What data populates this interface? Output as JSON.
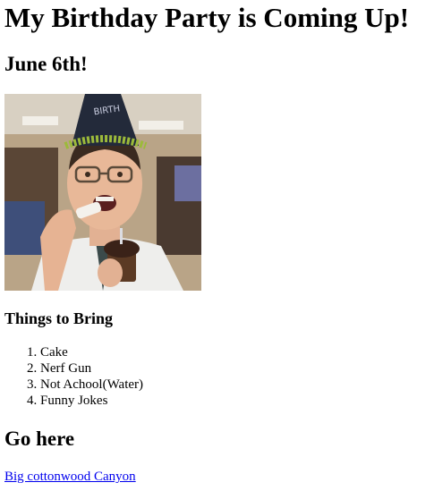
{
  "page": {
    "title": "My Birthday Party is Coming Up!",
    "date": "June 6th!"
  },
  "photo": {
    "alt": "party-guy-with-cupcake-image",
    "hat_text": "BIRTH"
  },
  "bring": {
    "heading": "Things to Bring",
    "items": [
      "Cake",
      "Nerf Gun",
      "Not Achool(Water)",
      "Funny Jokes"
    ]
  },
  "location": {
    "heading": "Go here",
    "link_text": "Big cottonwood Canyon"
  },
  "colors": {
    "link": "#0000ee",
    "text": "#000000",
    "background": "#ffffff"
  }
}
